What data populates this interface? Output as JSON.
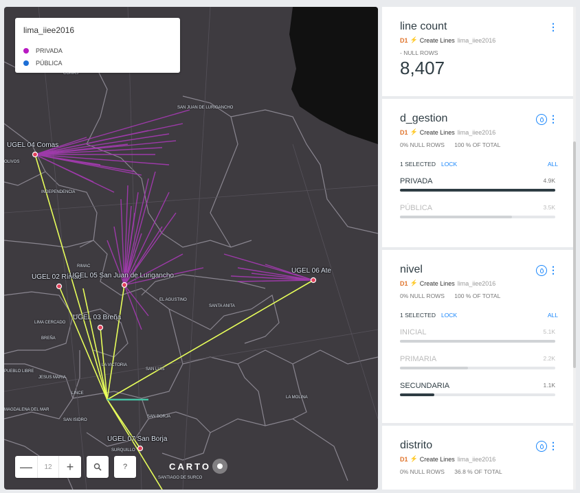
{
  "map": {
    "legend_title": "lima_iiee2016",
    "legend_items": [
      {
        "label": "PRIVADA",
        "color": "#b81ac2"
      },
      {
        "label": "PÚBLICA",
        "color": "#1d6fd6"
      }
    ],
    "zoom_level": "12",
    "zoom_out": "—",
    "zoom_in": "+",
    "search_glyph": "🔍",
    "help_glyph": "?",
    "attribution": "CARTO",
    "ugels": [
      "UGEL 04 Comas",
      "UGEL 02 Rímac",
      "UGEL 05 San Juan de Lurigancho",
      "UGEL 06 Ate",
      "UGEL 03 Breña",
      "UGEL 07 San Borja"
    ],
    "districts": [
      "COMAS",
      "SAN JUAN DE LURIGANCHO",
      "INDEPENDENCIA",
      "RIMAC",
      "EL AGUSTINO",
      "SANTA ANITA",
      "LIMA CERCADO",
      "BREÑA",
      "LA VICTORIA",
      "PUEBLO LIBRE",
      "JESUS MARIA",
      "LINCE",
      "SAN LUIS",
      "MAGDALENA DEL MAR",
      "SAN ISIDRO",
      "SAN BORJA",
      "LA MOLINA",
      "SURQUILLO",
      "SANTIAGO DE SURCO",
      "OLIVOS"
    ]
  },
  "widgets": {
    "line_count": {
      "title": "line count",
      "source": "D1",
      "analysis": "Create Lines",
      "layer": "lima_iiee2016",
      "null_rows": "- NULL ROWS",
      "value": "8,407"
    },
    "d_gestion": {
      "title": "d_gestion",
      "source": "D1",
      "analysis": "Create Lines",
      "layer": "lima_iiee2016",
      "null_rows": "0% NULL ROWS",
      "total": "100 % OF TOTAL",
      "selected": "1 SELECTED",
      "lock": "LOCK",
      "all": "ALL",
      "categories": [
        {
          "label": "PRIVADA",
          "value": "4.9k",
          "fraction": 1.0,
          "selected": true
        },
        {
          "label": "PÚBLICA",
          "value": "3.5k",
          "fraction": 0.72,
          "selected": false
        }
      ]
    },
    "nivel": {
      "title": "nivel",
      "source": "D1",
      "analysis": "Create Lines",
      "layer": "lima_iiee2016",
      "null_rows": "0% NULL ROWS",
      "total": "100 % OF TOTAL",
      "selected": "1 SELECTED",
      "lock": "LOCK",
      "all": "ALL",
      "categories": [
        {
          "label": "INICIAL",
          "value": "5.1k",
          "fraction": 1.0,
          "selected": false
        },
        {
          "label": "PRIMARIA",
          "value": "2.2k",
          "fraction": 0.44,
          "selected": false
        },
        {
          "label": "SECUNDARIA",
          "value": "1.1k",
          "fraction": 0.22,
          "selected": true
        }
      ]
    },
    "distrito": {
      "title": "distrito",
      "source": "D1",
      "analysis": "Create Lines",
      "layer": "lima_iiee2016",
      "null_rows": "0% NULL ROWS",
      "total": "36.8 % OF TOTAL"
    }
  },
  "colors": {
    "accent": "#1785fb",
    "source_tag": "#e0732a",
    "private_lines": "#a83ab5",
    "connector_lines": "#e8ff5a",
    "ugel_point": "#e0405a"
  }
}
